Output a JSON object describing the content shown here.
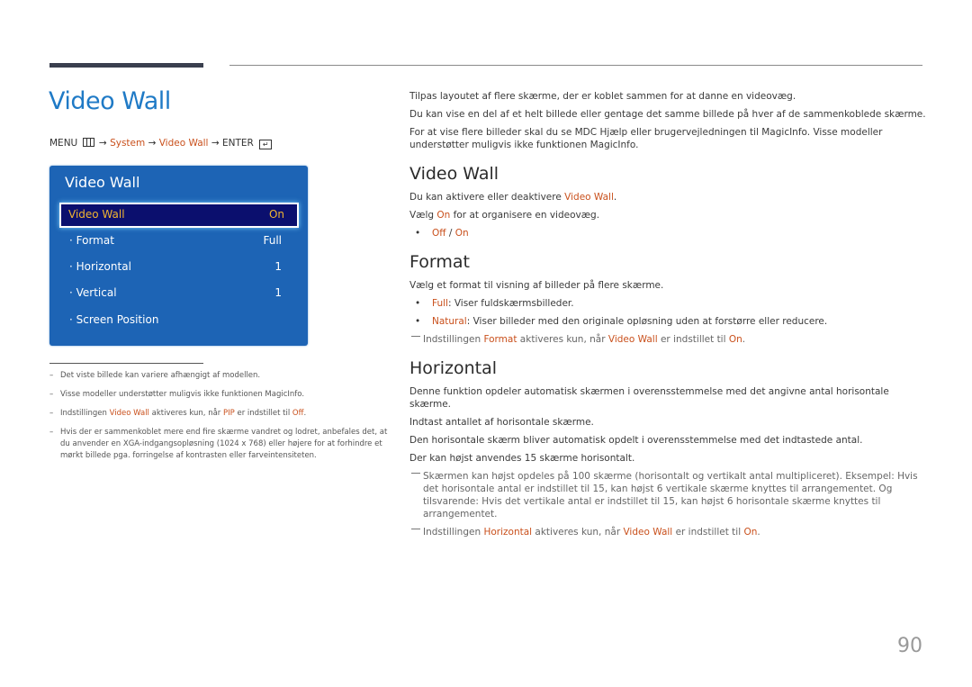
{
  "page_title": "Video Wall",
  "menu_path": {
    "menu": "MENU",
    "arrow": "→",
    "system": "System",
    "video_wall": "Video Wall",
    "enter": "ENTER"
  },
  "osd": {
    "title": "Video Wall",
    "selected": {
      "label": "Video Wall",
      "value": "On"
    },
    "rows": [
      {
        "label": "· Format",
        "value": "Full"
      },
      {
        "label": "· Horizontal",
        "value": "1"
      },
      {
        "label": "· Vertical",
        "value": "1"
      },
      {
        "label": "· Screen Position",
        "value": ""
      }
    ]
  },
  "left_notes": [
    {
      "text": "Det viste billede kan variere afhængigt af modellen."
    },
    {
      "text": "Visse modeller understøtter muligvis ikke funktionen MagicInfo."
    },
    {
      "pre": "Indstillingen ",
      "hl1": "Video Wall",
      "mid": " aktiveres kun, når ",
      "hl2": "PIP",
      "mid2": " er indstillet til ",
      "hl3": "Off",
      "post": "."
    },
    {
      "text": "Hvis der er sammenkoblet mere end fire skærme vandret og lodret, anbefales det, at du anvender en XGA-indgangsopløsning (1024 x 768) eller højere for at forhindre et mørkt billede pga. forringelse af kontrasten eller farveintensiteten."
    }
  ],
  "intro": [
    "Tilpas layoutet af flere skærme, der er koblet sammen for at danne en videovæg.",
    "Du kan vise en del af et helt billede eller gentage det samme billede på hver af de sammenkoblede skærme.",
    "For at vise flere billeder skal du se MDC Hjælp eller brugervejledningen til MagicInfo. Visse modeller understøtter muligvis ikke funktionen MagicInfo."
  ],
  "sections": {
    "video_wall": {
      "heading": "Video Wall",
      "p1_pre": "Du kan aktivere eller deaktivere ",
      "p1_hl": "Video Wall",
      "p1_post": ".",
      "p2_pre": "Vælg ",
      "p2_hl": "On",
      "p2_post": " for at organisere en videovæg.",
      "bullet_off": "Off",
      "bullet_sep": " / ",
      "bullet_on": "On"
    },
    "format": {
      "heading": "Format",
      "p1": "Vælg et format til visning af billeder på flere skærme.",
      "b1_hl": "Full",
      "b1_text": ": Viser fuldskærmsbilleder.",
      "b2_hl": "Natural",
      "b2_text": ": Viser billeder med den originale opløsning uden at forstørre eller reducere.",
      "note_pre": "Indstillingen ",
      "note_hl1": "Format",
      "note_mid": " aktiveres kun, når ",
      "note_hl2": "Video Wall",
      "note_mid2": " er indstillet til ",
      "note_hl3": "On",
      "note_post": "."
    },
    "horizontal": {
      "heading": "Horizontal",
      "p1": "Denne funktion opdeler automatisk skærmen i overensstemmelse med det angivne antal horisontale skærme.",
      "p2": "Indtast antallet af horisontale skærme.",
      "p3": "Den horisontale skærm bliver automatisk opdelt i overensstemmelse med det indtastede antal.",
      "p4": "Der kan højst anvendes 15 skærme horisontalt.",
      "note1": "Skærmen kan højst opdeles på 100 skærme (horisontalt og vertikalt antal multipliceret). Eksempel: Hvis det horisontale antal er indstillet til 15, kan højst 6 vertikale skærme knyttes til arrangementet. Og tilsvarende: Hvis det vertikale antal er indstillet til 15, kan højst 6 horisontale skærme knyttes til arrangementet.",
      "note2_pre": "Indstillingen ",
      "note2_hl1": "Horizontal",
      "note2_mid": " aktiveres kun, når ",
      "note2_hl2": "Video Wall",
      "note2_mid2": " er indstillet til ",
      "note2_hl3": "On",
      "note2_post": "."
    }
  },
  "page_number": "90",
  "colors": {
    "title_blue": "#1f7ac6",
    "highlight": "#c9501c",
    "osd_bg": "#1d64b5",
    "osd_selected": "#0b0f6e",
    "osd_selected_text": "#f0b431"
  }
}
